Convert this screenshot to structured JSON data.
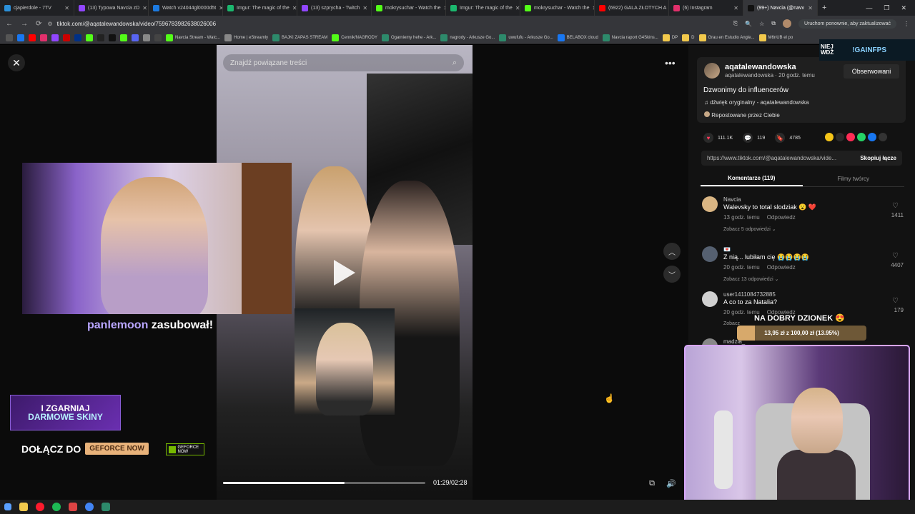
{
  "browser": {
    "tabs": [
      {
        "label": "cjapierdole - 7TV",
        "color": "#2b90d9"
      },
      {
        "label": "(13) Typowa Navcia zD",
        "color": "#9146ff"
      },
      {
        "label": "Watch v24044gl0000d5t",
        "color": "#1c7ae0"
      },
      {
        "label": "Imgur: The magic of the",
        "color": "#1bb76e"
      },
      {
        "label": "(13) szprycha - Twitch",
        "color": "#9146ff"
      },
      {
        "label": "mokrysuchar - Watch the",
        "color": "#53fc18"
      },
      {
        "label": "Imgur: The magic of the",
        "color": "#1bb76e"
      },
      {
        "label": "mokrysuchar - Watch the",
        "color": "#53fc18"
      },
      {
        "label": "(6922) GALA ZŁOTYCH A",
        "color": "#ff0000"
      },
      {
        "label": "(6) Instagram",
        "color": "#e1306c"
      },
      {
        "label": "(99+) Navcia (@navv",
        "color": "#111111"
      }
    ],
    "url": "tiktok.com/@aqatalewandowska/video/7596783982638026006",
    "update_label": "Uruchom ponownie, aby zaktualizować",
    "bookmarks": [
      "Navcia Stream - Watc...",
      "Home | eStreamly",
      "BAJKI ZAPAS STREAM",
      "Cennik/NAGRODY",
      "Ogarniemy hehe - Ark...",
      "nagrody - Arkusze Go...",
      "uwufufu - Arkusze Go...",
      "BELABOX cloud",
      "Navcia raport G4Skins...",
      "DP",
      "D",
      "Grau en Estudio Angle...",
      "M6nUB el po"
    ]
  },
  "video": {
    "search_placeholder": "Znajdź powiązane treści",
    "time": "01:29/02:28",
    "progress": 0.6
  },
  "overlay": {
    "sub_user": "panlemoon",
    "sub_text": "zasubował!",
    "promo_line1": "I ZGARNIAJ",
    "promo_line2": "DARMOWE SKINY",
    "join_label": "DOŁĄCZ DO",
    "geforce_label": "GEFORCE NOW",
    "nv_badge": "GEFORCE NOW",
    "igainfps_small1": "NIEJ",
    "igainfps_small2": "WDŻ",
    "igainfps": "!GAINFPS",
    "goal_title": "NA DOBRY DZIONEK 😍",
    "goal_text": "13,95 zł z 100,00 zł (13.95%)",
    "goal_fraction": 0.1395
  },
  "post": {
    "username": "aqatalewandowska",
    "meta": "aqatalewandowska · 20 godz. temu",
    "follow_label": "Obserwowani",
    "description": "Dzwonimy do influencerów",
    "music": "dźwięk oryginalny - aqatalewandowska",
    "repost": "Repostowane przez Ciebie",
    "likes": "111.1K",
    "comments": "119",
    "saves": "4785",
    "link": "https://www.tiktok.com/@aqatalewandowska/vide...",
    "copy_label": "Skopiuj łącze",
    "tab_comments": "Komentarze (119)",
    "tab_creator": "Filmy twórcy"
  },
  "comments": [
    {
      "name": "Navcia",
      "text": "Walevsky to total slodziak 😮 ❤️",
      "time": "13 godz. temu",
      "reply": "Odpowiedz",
      "replies": "Zobacz 5 odpowiedzi ⌄",
      "likes": "1411",
      "avatar": "#d9b583"
    },
    {
      "name": "💌",
      "text": "Z nią... lubiłam cię 😭😭😭😭",
      "time": "20 godz. temu",
      "reply": "Odpowiedz",
      "replies": "Zobacz 13 odpowiedzi ⌄",
      "likes": "4407",
      "avatar": "#556070"
    },
    {
      "name": "user1411084732885",
      "text": "A co to za Natalia?",
      "time": "20 godz. temu",
      "reply": "Odpowiedz",
      "replies": "Zobacz",
      "likes": "179",
      "avatar": "#d0d0d0"
    },
    {
      "name": "madzia_",
      "text": "",
      "time": "",
      "reply": "",
      "replies": "",
      "likes": "",
      "avatar": "#888888"
    }
  ],
  "colors": {
    "accent_purple": "#b9a6ff",
    "goal_bar": "#d7a96b",
    "webcam_border": "#d8a6ff",
    "heart": "#ff3b5c"
  }
}
